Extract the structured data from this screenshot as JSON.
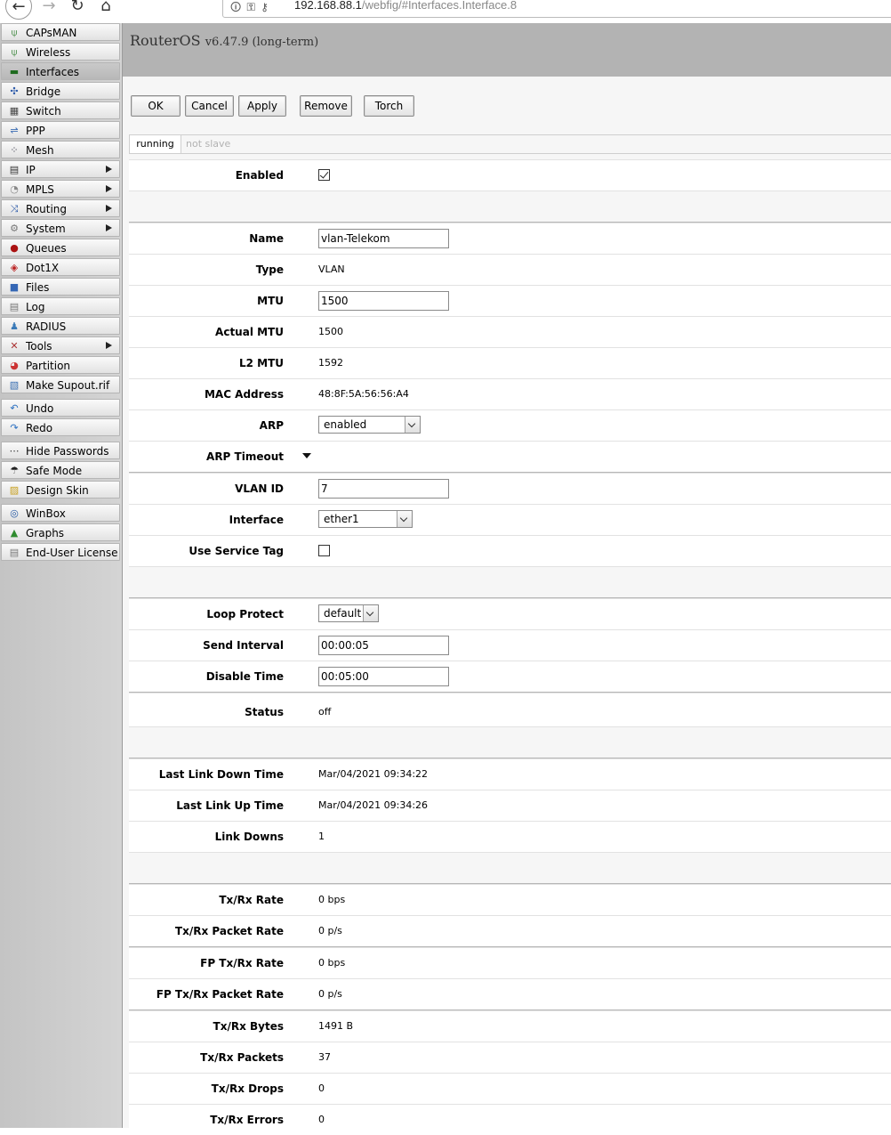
{
  "browser": {
    "url_host": "192.168.88.1",
    "url_path": "/webfig/#Interfaces.Interface.8"
  },
  "sidebar": {
    "items": [
      {
        "label": "CAPsMAN",
        "icon": "antenna-icon",
        "submenu": false
      },
      {
        "label": "Wireless",
        "icon": "antenna-icon",
        "submenu": false
      },
      {
        "label": "Interfaces",
        "icon": "network-card-icon",
        "submenu": false,
        "active": true
      },
      {
        "label": "Bridge",
        "icon": "bridge-icon",
        "submenu": false
      },
      {
        "label": "Switch",
        "icon": "switch-icon",
        "submenu": false
      },
      {
        "label": "PPP",
        "icon": "ppp-icon",
        "submenu": false
      },
      {
        "label": "Mesh",
        "icon": "mesh-icon",
        "submenu": false
      },
      {
        "label": "IP",
        "icon": "ip-icon",
        "submenu": true
      },
      {
        "label": "MPLS",
        "icon": "mpls-icon",
        "submenu": true
      },
      {
        "label": "Routing",
        "icon": "routing-icon",
        "submenu": true
      },
      {
        "label": "System",
        "icon": "gear-icon",
        "submenu": true
      },
      {
        "label": "Queues",
        "icon": "queues-icon",
        "submenu": false
      },
      {
        "label": "Dot1X",
        "icon": "dot1x-icon",
        "submenu": false
      },
      {
        "label": "Files",
        "icon": "folder-icon",
        "submenu": false
      },
      {
        "label": "Log",
        "icon": "log-icon",
        "submenu": false
      },
      {
        "label": "RADIUS",
        "icon": "users-icon",
        "submenu": false
      },
      {
        "label": "Tools",
        "icon": "tools-icon",
        "submenu": true
      },
      {
        "label": "Partition",
        "icon": "pie-icon",
        "submenu": false
      },
      {
        "label": "Make Supout.rif",
        "icon": "document-icon",
        "submenu": false
      },
      {
        "label": "Undo",
        "icon": "undo-icon",
        "submenu": false
      },
      {
        "label": "Redo",
        "icon": "redo-icon",
        "submenu": false
      },
      {
        "label": "Hide Passwords",
        "icon": "dots-icon",
        "submenu": false
      },
      {
        "label": "Safe Mode",
        "icon": "umbrella-icon",
        "submenu": false
      },
      {
        "label": "Design Skin",
        "icon": "palette-icon",
        "submenu": false
      },
      {
        "label": "WinBox",
        "icon": "winbox-icon",
        "submenu": false
      },
      {
        "label": "Graphs",
        "icon": "graph-icon",
        "submenu": false
      },
      {
        "label": "End-User License",
        "icon": "license-icon",
        "submenu": false
      }
    ]
  },
  "header": {
    "brand": "RouterOS",
    "version": "v6.47.9 (long-term)"
  },
  "toolbar": {
    "ok": "OK",
    "cancel": "Cancel",
    "apply": "Apply",
    "remove": "Remove",
    "torch": "Torch"
  },
  "status": {
    "running": "running",
    "not_slave": "not slave"
  },
  "form": {
    "enabled": {
      "label": "Enabled",
      "checked": true
    },
    "name": {
      "label": "Name",
      "value": "vlan-Telekom"
    },
    "type": {
      "label": "Type",
      "value": "VLAN"
    },
    "mtu": {
      "label": "MTU",
      "value": "1500"
    },
    "actual_mtu": {
      "label": "Actual MTU",
      "value": "1500"
    },
    "l2_mtu": {
      "label": "L2 MTU",
      "value": "1592"
    },
    "mac": {
      "label": "MAC Address",
      "value": "48:8F:5A:56:56:A4"
    },
    "arp": {
      "label": "ARP",
      "value": "enabled"
    },
    "arp_timeout": {
      "label": "ARP Timeout"
    },
    "vlan_id": {
      "label": "VLAN ID",
      "value": "7"
    },
    "interface": {
      "label": "Interface",
      "value": "ether1"
    },
    "use_service_tag": {
      "label": "Use Service Tag",
      "checked": false
    },
    "loop_protect": {
      "label": "Loop Protect",
      "value": "default"
    },
    "send_interval": {
      "label": "Send Interval",
      "value": "00:00:05"
    },
    "disable_time": {
      "label": "Disable Time",
      "value": "00:05:00"
    },
    "status": {
      "label": "Status",
      "value": "off"
    },
    "last_link_down": {
      "label": "Last Link Down Time",
      "value": "Mar/04/2021 09:34:22"
    },
    "last_link_up": {
      "label": "Last Link Up Time",
      "value": "Mar/04/2021 09:34:26"
    },
    "link_downs": {
      "label": "Link Downs",
      "value": "1"
    },
    "txrx_rate": {
      "label": "Tx/Rx Rate",
      "value": "0 bps"
    },
    "txrx_packet_rate": {
      "label": "Tx/Rx Packet Rate",
      "value": "0 p/s"
    },
    "fp_txrx_rate": {
      "label": "FP Tx/Rx Rate",
      "value": "0 bps"
    },
    "fp_txrx_packet_rate": {
      "label": "FP Tx/Rx Packet Rate",
      "value": "0 p/s"
    },
    "txrx_bytes": {
      "label": "Tx/Rx Bytes",
      "value": "1491 B"
    },
    "txrx_packets": {
      "label": "Tx/Rx Packets",
      "value": "37"
    },
    "txrx_drops": {
      "label": "Tx/Rx Drops",
      "value": "0"
    },
    "txrx_errors": {
      "label": "Tx/Rx Errors",
      "value": "0"
    }
  }
}
